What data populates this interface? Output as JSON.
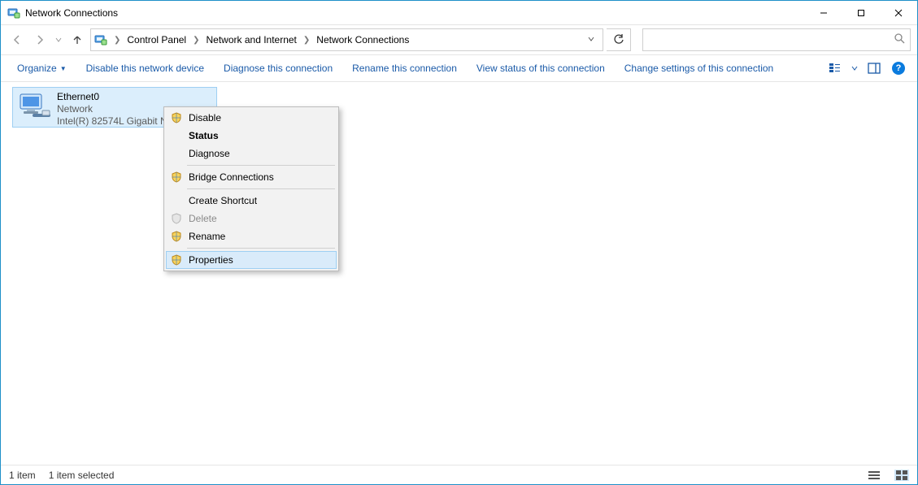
{
  "window": {
    "title": "Network Connections"
  },
  "nav": {
    "back_enabled": false,
    "forward_enabled": false
  },
  "breadcrumbs": {
    "a": "Control Panel",
    "b": "Network and Internet",
    "c": "Network Connections"
  },
  "search": {
    "placeholder": ""
  },
  "commands": {
    "organize": "Organize",
    "disable": "Disable this network device",
    "diagnose": "Diagnose this connection",
    "rename": "Rename this connection",
    "viewstatus": "View status of this connection",
    "changesettings": "Change settings of this connection"
  },
  "adapter": {
    "name": "Ethernet0",
    "status": "Network",
    "device": "Intel(R) 82574L Gigabit N"
  },
  "context_menu": {
    "disable": "Disable",
    "status": "Status",
    "diagnose": "Diagnose",
    "bridge": "Bridge Connections",
    "shortcut": "Create Shortcut",
    "delete": "Delete",
    "rename": "Rename",
    "properties": "Properties"
  },
  "statusbar": {
    "count": "1 item",
    "selected": "1 item selected"
  }
}
